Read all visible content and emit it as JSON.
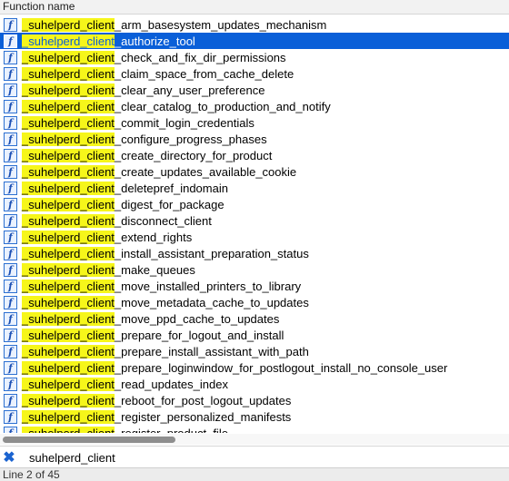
{
  "header": {
    "column_title": "Function name"
  },
  "search": {
    "query": "suhelperd_client",
    "highlight": "suhelperd_client"
  },
  "selected_index": 1,
  "functions": [
    {
      "prefix": "_",
      "match": "suhelperd_client",
      "suffix": "_arm_basesystem_updates_mechanism"
    },
    {
      "prefix": "_",
      "match": "suhelperd_client",
      "suffix": "_authorize_tool"
    },
    {
      "prefix": "_",
      "match": "suhelperd_client",
      "suffix": "_check_and_fix_dir_permissions"
    },
    {
      "prefix": "_",
      "match": "suhelperd_client",
      "suffix": "_claim_space_from_cache_delete"
    },
    {
      "prefix": "_",
      "match": "suhelperd_client",
      "suffix": "_clear_any_user_preference"
    },
    {
      "prefix": "_",
      "match": "suhelperd_client",
      "suffix": "_clear_catalog_to_production_and_notify"
    },
    {
      "prefix": "_",
      "match": "suhelperd_client",
      "suffix": "_commit_login_credentials"
    },
    {
      "prefix": "_",
      "match": "suhelperd_client",
      "suffix": "_configure_progress_phases"
    },
    {
      "prefix": "_",
      "match": "suhelperd_client",
      "suffix": "_create_directory_for_product"
    },
    {
      "prefix": "_",
      "match": "suhelperd_client",
      "suffix": "_create_updates_available_cookie"
    },
    {
      "prefix": "_",
      "match": "suhelperd_client",
      "suffix": "_deletepref_indomain"
    },
    {
      "prefix": "_",
      "match": "suhelperd_client",
      "suffix": "_digest_for_package"
    },
    {
      "prefix": "_",
      "match": "suhelperd_client",
      "suffix": "_disconnect_client"
    },
    {
      "prefix": "_",
      "match": "suhelperd_client",
      "suffix": "_extend_rights"
    },
    {
      "prefix": "_",
      "match": "suhelperd_client",
      "suffix": "_install_assistant_preparation_status"
    },
    {
      "prefix": "_",
      "match": "suhelperd_client",
      "suffix": "_make_queues"
    },
    {
      "prefix": "_",
      "match": "suhelperd_client",
      "suffix": "_move_installed_printers_to_library"
    },
    {
      "prefix": "_",
      "match": "suhelperd_client",
      "suffix": "_move_metadata_cache_to_updates"
    },
    {
      "prefix": "_",
      "match": "suhelperd_client",
      "suffix": "_move_ppd_cache_to_updates"
    },
    {
      "prefix": "_",
      "match": "suhelperd_client",
      "suffix": "_prepare_for_logout_and_install"
    },
    {
      "prefix": "_",
      "match": "suhelperd_client",
      "suffix": "_prepare_install_assistant_with_path"
    },
    {
      "prefix": "_",
      "match": "suhelperd_client",
      "suffix": "_prepare_loginwindow_for_postlogout_install_no_console_user"
    },
    {
      "prefix": "_",
      "match": "suhelperd_client",
      "suffix": "_read_updates_index"
    },
    {
      "prefix": "_",
      "match": "suhelperd_client",
      "suffix": "_reboot_for_post_logout_updates"
    },
    {
      "prefix": "_",
      "match": "suhelperd_client",
      "suffix": "_register_personalized_manifests"
    },
    {
      "prefix": "_",
      "match": "suhelperd_client",
      "suffix": "_register_product_file"
    }
  ],
  "icons": {
    "function": "function-icon",
    "clear": "clear-search-icon"
  },
  "colors": {
    "selection": "#0a5fd8",
    "highlight": "#f6f61a",
    "icon_border": "#2b6fd1"
  },
  "status": {
    "text": "Line 2 of 45"
  }
}
